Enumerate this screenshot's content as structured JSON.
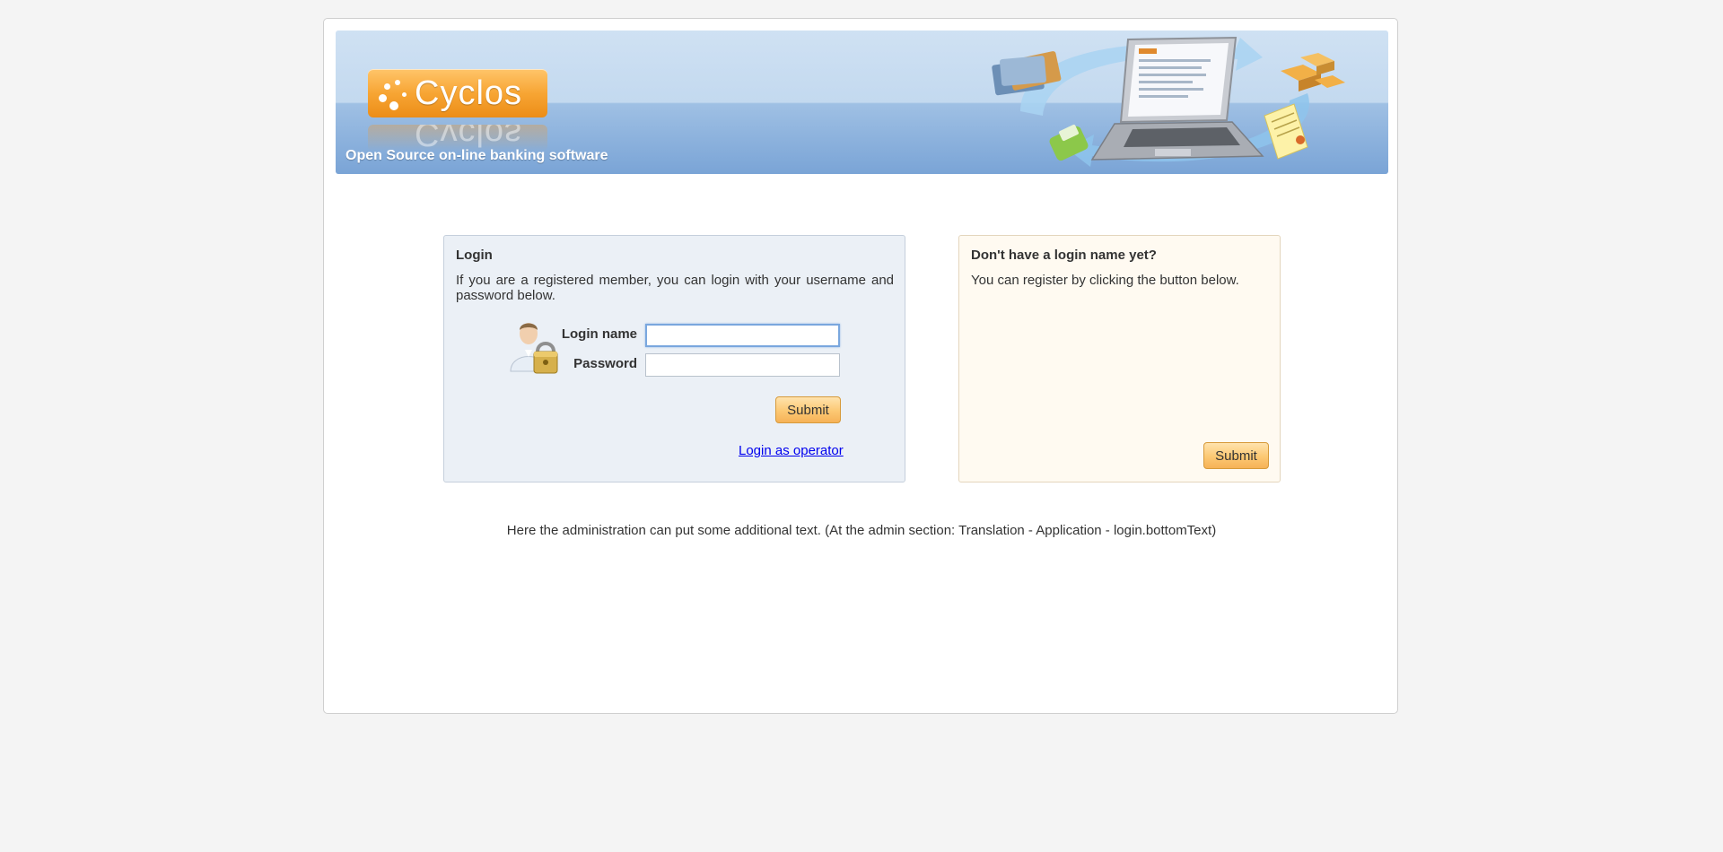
{
  "banner": {
    "logo_text": "Cyclos",
    "tagline": "Open Source on-line banking software"
  },
  "login": {
    "title": "Login",
    "description": "If you are a registered member, you can login with your username and password below.",
    "login_name_label": "Login name",
    "login_name_value": "",
    "password_label": "Password",
    "password_value": "",
    "submit_label": "Submit",
    "operator_link": "Login as operator"
  },
  "register": {
    "title": "Don't have a login name yet?",
    "description": "You can register by clicking the button below.",
    "submit_label": "Submit"
  },
  "footer": {
    "bottom_text": "Here the administration can put some additional text. (At the admin section: Translation - Application - login.bottomText)"
  },
  "colors": {
    "page_bg": "#f4f4f4",
    "login_panel_bg": "#ebf0f6",
    "register_panel_bg": "#fffaf1",
    "button_accent": "#fcc873",
    "logo_orange": "#f7a534",
    "link": "#0000ee"
  },
  "icons": {
    "logo": "cyclos-dots-logo",
    "login_illustration": "user-lock-icon",
    "banner_art": "laptop-cards-arrows-illustration"
  }
}
